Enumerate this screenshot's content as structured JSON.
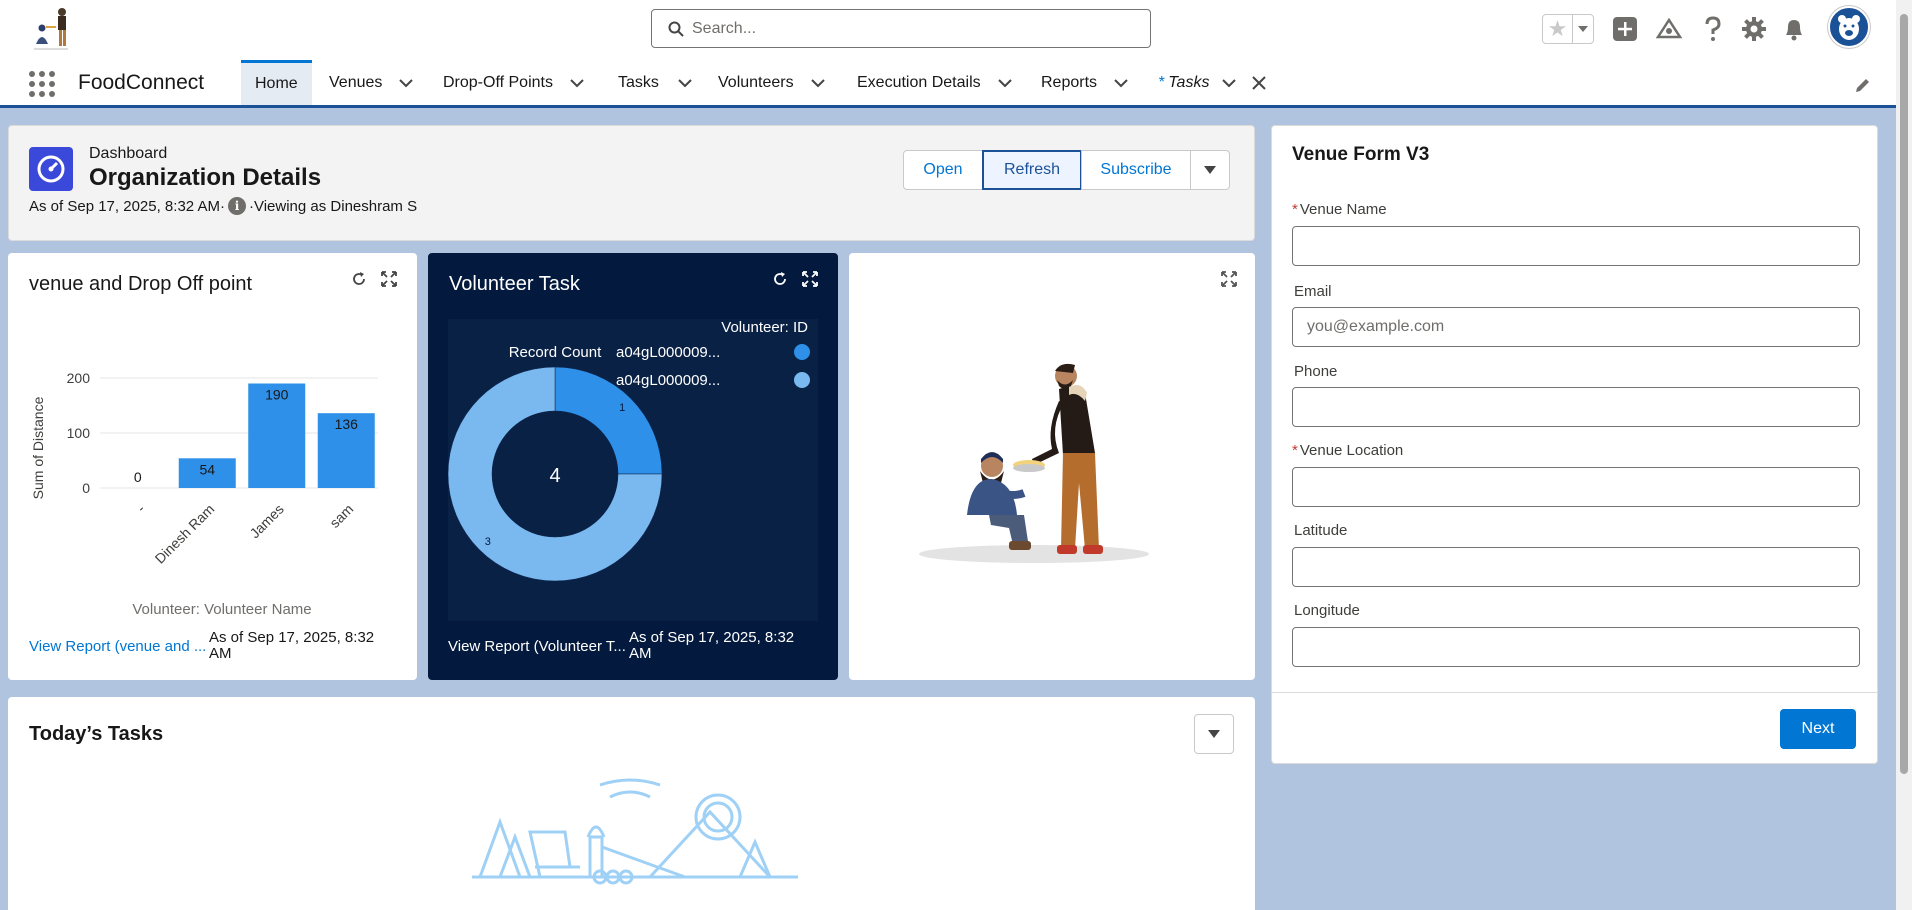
{
  "header": {
    "search_placeholder": "Search..."
  },
  "nav": {
    "app_name": "FoodConnect",
    "tabs": [
      {
        "label": "Home"
      },
      {
        "label": "Venues"
      },
      {
        "label": "Drop-Off Points"
      },
      {
        "label": "Tasks"
      },
      {
        "label": "Volunteers"
      },
      {
        "label": "Execution Details"
      },
      {
        "label": "Reports"
      },
      {
        "label": "Tasks",
        "prefix": "*"
      }
    ]
  },
  "dashboard": {
    "type": "Dashboard",
    "title": "Organization Details",
    "as_of": "As of Sep 17, 2025, 8:32 AM·",
    "viewing_as": "·Viewing as Dineshram S",
    "info_glyph": "i",
    "buttons": {
      "open": "Open",
      "refresh": "Refresh",
      "subscribe": "Subscribe"
    }
  },
  "widget_venue": {
    "title": "venue and Drop Off point",
    "footer_link": "View Report (venue and ...",
    "footer_date": "As of Sep 17, 2025, 8:32 AM"
  },
  "widget_volunteer": {
    "title": "Volunteer Task",
    "footer_link": "View Report (Volunteer T...",
    "footer_date": "As of Sep 17, 2025, 8:32 AM"
  },
  "form": {
    "title": "Venue Form V3",
    "fields": [
      {
        "label": "Venue Name",
        "required": "*",
        "placeholder": ""
      },
      {
        "label": "Email",
        "required": "",
        "placeholder": "you@example.com"
      },
      {
        "label": "Phone",
        "required": "",
        "placeholder": ""
      },
      {
        "label": "Venue Location",
        "required": "*",
        "placeholder": ""
      },
      {
        "label": "Latitude",
        "required": "",
        "placeholder": ""
      },
      {
        "label": "Longitude",
        "required": "",
        "placeholder": ""
      }
    ],
    "next_label": "Next"
  },
  "tasks": {
    "title": "Today’s Tasks"
  },
  "colors": {
    "brand": "#0176d3",
    "nav_accent": "#1b5297",
    "bar": "#2e90e8",
    "donut_dark": "#2e90e8",
    "donut_light": "#7ab8f0",
    "dark_widget": "#03193d"
  },
  "chart_data": [
    {
      "type": "bar",
      "categories": [
        "-",
        "Dinesh Ram",
        "James",
        "sam"
      ],
      "values": [
        0,
        54,
        190,
        136
      ],
      "xlabel": "Volunteer: Volunteer Name",
      "ylabel": "Sum of Distance",
      "yticks": [
        "0",
        "100",
        "200"
      ],
      "ylim": [
        0,
        200
      ],
      "grid": true
    },
    {
      "type": "pie",
      "title": "Record Count",
      "legend_title": "Volunteer: ID",
      "legend_placement": "right",
      "series": [
        {
          "name": "a04gL000009...",
          "value": 1
        },
        {
          "name": "a04gL000009...",
          "value": 3
        }
      ],
      "total": "4",
      "slice_labels": [
        "1",
        "3"
      ]
    }
  ]
}
